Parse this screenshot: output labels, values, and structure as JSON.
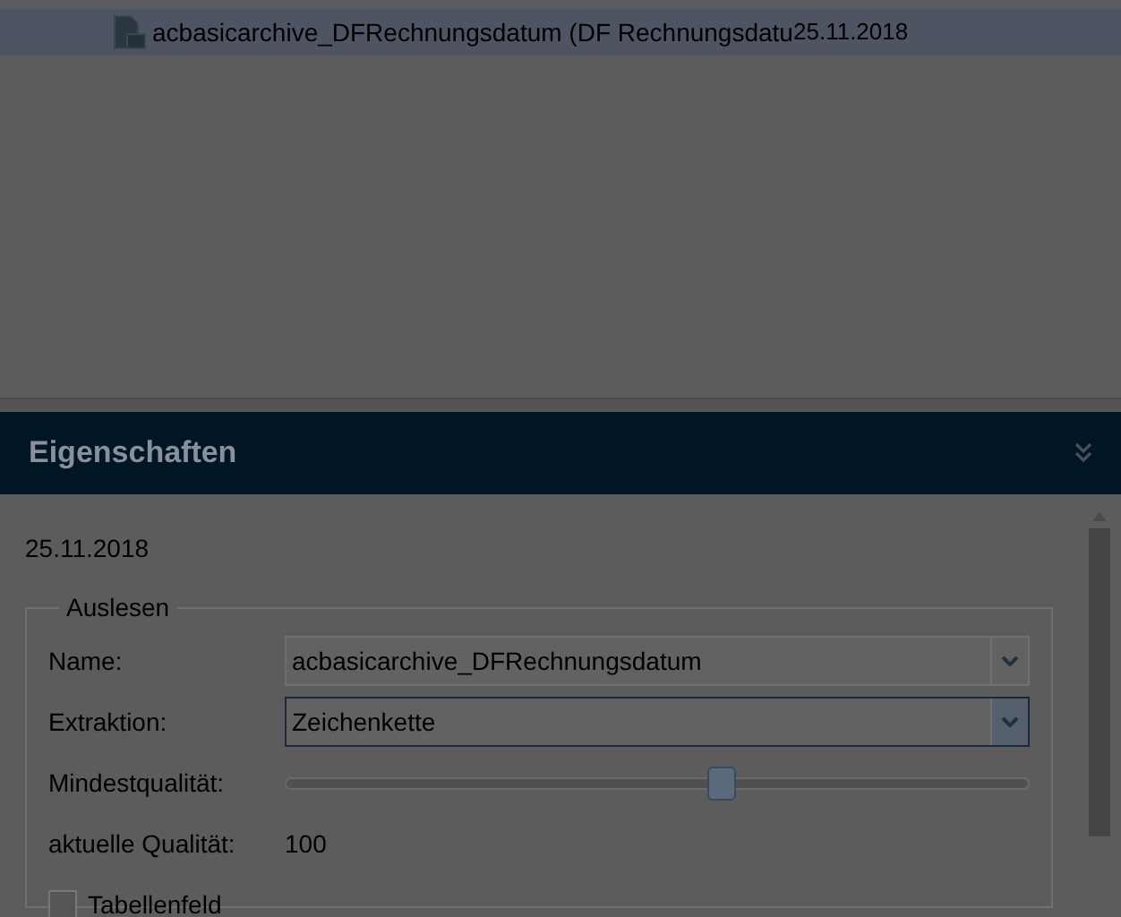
{
  "list": {
    "rows": [
      {
        "name": "acbasicarchive_DFRechnungsdatum (DF Rechnungsdatu",
        "date": "25.11.2018",
        "selected": true
      }
    ]
  },
  "properties": {
    "title": "Eigenschaften",
    "heading": "25.11.2018",
    "group": {
      "title": "Auslesen",
      "name": {
        "label": "Name:",
        "value": "acbasicarchive_DFRechnungsdatum"
      },
      "extraction": {
        "label": "Extraktion:",
        "value": "Zeichenkette"
      },
      "min_quality": {
        "label": "Mindestqualität:",
        "level": 0.59
      },
      "current_quality": {
        "label": "aktuelle Qualität:",
        "value": "100"
      },
      "table_field": {
        "label": "Tabellenfeld",
        "checked": false
      }
    }
  }
}
